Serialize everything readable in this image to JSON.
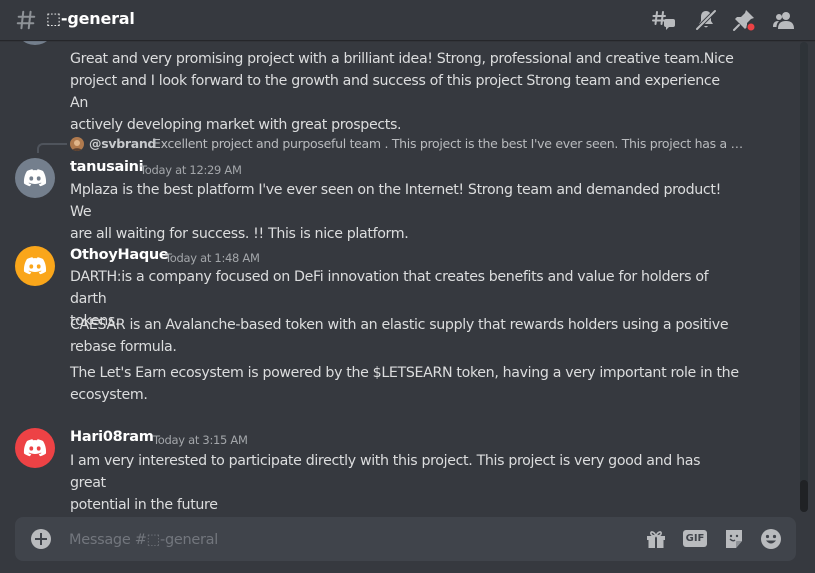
{
  "header": {
    "channel_name": "⬚-general",
    "icons": [
      "threads-icon",
      "notification-muted-icon",
      "pin-icon",
      "member-list-icon"
    ]
  },
  "messages": [
    {
      "text_lines": [
        "Great and very promising project with a brilliant idea! Strong, professional and creative team.Nice",
        "project and I look forward to the growth and success of this project Strong team and experience An",
        "actively developing market with great prospects."
      ]
    },
    {
      "reply": {
        "author": "@svbrand",
        "text": "Excellent project and purposeful team . This project is the best I've ever seen. This project has a bright future"
      },
      "author": "tanusaini",
      "timestamp": "Today at 12:29 AM",
      "avatar_color": "#747f8d",
      "text_lines": [
        "Mplaza  is the best platform  I've ever seen on the Internet! Strong team and demanded product! We",
        "are all waiting for success. !! This is nice platform."
      ]
    },
    {
      "author": "OthoyHaque",
      "timestamp": "Today at 1:48 AM",
      "avatar_color": "#faa61a",
      "paragraphs": [
        [
          "DARTH:is a company focused on DeFi innovation that creates benefits and value for holders of darth",
          "tokens."
        ],
        [
          "CAESAR is an Avalanche-based token with an elastic supply that rewards holders using a positive",
          "rebase formula."
        ],
        [
          "The Let's Earn ecosystem is powered by the $LETSEARN token, having a very important role in the",
          "ecosystem."
        ]
      ]
    },
    {
      "author": "Hari08ram",
      "timestamp": "Today at 3:15 AM",
      "avatar_color": "#ed4245",
      "text_lines": [
        "I am very interested to participate directly with this project. This project is very good and has great",
        "potential in the future"
      ]
    }
  ],
  "composer": {
    "placeholder": "Message #⬚-general",
    "icons": [
      "gift-icon",
      "gif-icon",
      "sticker-icon",
      "emoji-icon"
    ],
    "gif_label": "GIF"
  },
  "colors": {
    "background": "#36393f",
    "composer_bg": "#40444b",
    "text": "#dcddde",
    "username": "#ffffff",
    "muted": "#72767d",
    "notification_dot": "#ed4245"
  }
}
